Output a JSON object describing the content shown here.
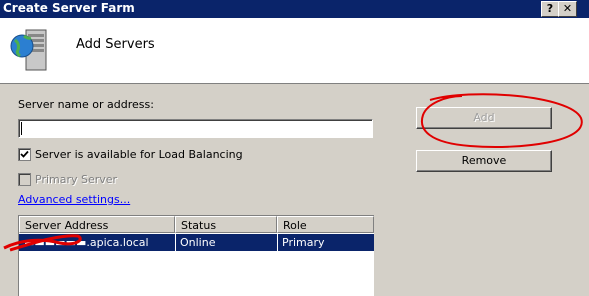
{
  "window": {
    "title": "Create Server Farm",
    "help_button": "?",
    "close_button": "✕"
  },
  "header": {
    "title": "Add Servers",
    "icon": "server-globe-icon"
  },
  "form": {
    "server_label": "Server name or address:",
    "server_value": "",
    "load_balancing_label": "Server is available for Load Balancing",
    "load_balancing_checked": true,
    "primary_label": "Primary Server",
    "primary_checked": false,
    "advanced_link": "Advanced settings..."
  },
  "buttons": {
    "add": "Add",
    "remove": "Remove"
  },
  "table": {
    "columns": [
      "Server Address",
      "Status",
      "Role"
    ],
    "rows": [
      {
        "address": "▬▬▬▬▬▬.apica.local",
        "status": "Online",
        "role": "Primary"
      }
    ]
  },
  "colors": {
    "titlebar": "#0a246a",
    "selection": "#0a246a",
    "annotation": "#e00000"
  }
}
